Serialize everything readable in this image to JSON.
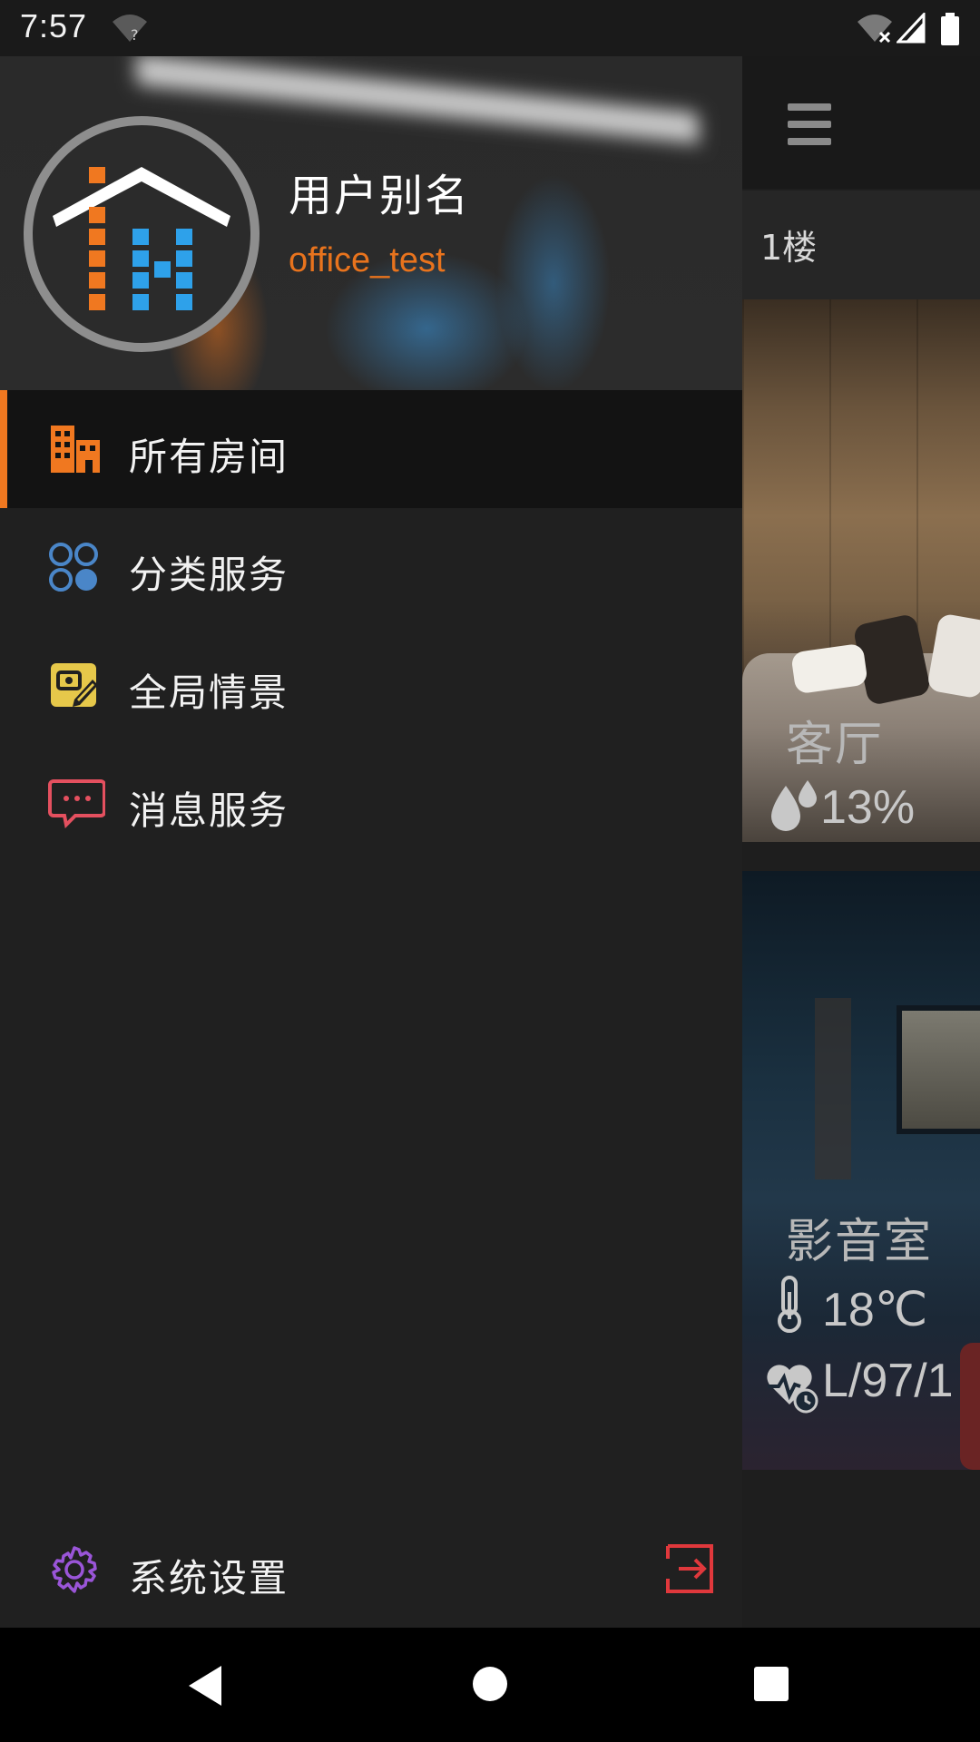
{
  "status_bar": {
    "time": "7:57"
  },
  "background": {
    "floor_label": "1楼",
    "rooms": [
      {
        "name": "客厅",
        "humidity": "13%"
      },
      {
        "name": "影音室",
        "temperature": "18℃",
        "health_value": "L/97/1"
      }
    ]
  },
  "drawer": {
    "user_alias": "用户别名",
    "account": "office_test",
    "menu": [
      {
        "label": "所有房间",
        "icon": "building-icon",
        "active": true
      },
      {
        "label": "分类服务",
        "icon": "category-circles-icon",
        "active": false
      },
      {
        "label": "全局情景",
        "icon": "scene-edit-icon",
        "active": false
      },
      {
        "label": "消息服务",
        "icon": "message-bubble-icon",
        "active": false
      }
    ],
    "settings_label": "系统设置",
    "settings_icon": "gear-icon",
    "logout_icon": "logout-icon"
  },
  "colors": {
    "accent": "#f07820",
    "account_text": "#e8731d",
    "category_icon": "#4a86c8",
    "scene_icon": "#e6c84a",
    "message_icon": "#e4505f",
    "settings_icon": "#9a55d8",
    "logout_icon": "#e0383c"
  }
}
